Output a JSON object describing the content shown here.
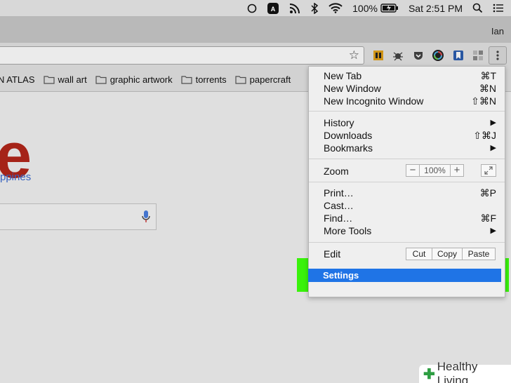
{
  "menubar": {
    "battery": "100%",
    "clock": "Sat 2:51 PM"
  },
  "window": {
    "profile_name": "Ian"
  },
  "bookmarks": [
    {
      "label": "N ATLAS"
    },
    {
      "label": "wall art"
    },
    {
      "label": "graphic artwork"
    },
    {
      "label": "torrents"
    },
    {
      "label": "papercraft"
    }
  ],
  "page": {
    "logo_fragment": "e",
    "region_label": "ppines"
  },
  "menu": {
    "new_tab": {
      "label": "New Tab",
      "shortcut": "⌘T"
    },
    "new_window": {
      "label": "New Window",
      "shortcut": "⌘N"
    },
    "new_incognito": {
      "label": "New Incognito Window",
      "shortcut": "⇧⌘N"
    },
    "history": {
      "label": "History"
    },
    "downloads": {
      "label": "Downloads",
      "shortcut": "⇧⌘J"
    },
    "bookmarks": {
      "label": "Bookmarks"
    },
    "zoom": {
      "label": "Zoom",
      "minus": "−",
      "value": "100%",
      "plus": "+"
    },
    "print": {
      "label": "Print…",
      "shortcut": "⌘P"
    },
    "cast": {
      "label": "Cast…"
    },
    "find": {
      "label": "Find…",
      "shortcut": "⌘F"
    },
    "more_tools": {
      "label": "More Tools"
    },
    "edit": {
      "label": "Edit",
      "cut": "Cut",
      "copy": "Copy",
      "paste": "Paste"
    },
    "settings": {
      "label": "Settings"
    },
    "submenu_arrow": "▶"
  },
  "watermark": {
    "text": "Healthy Living"
  }
}
